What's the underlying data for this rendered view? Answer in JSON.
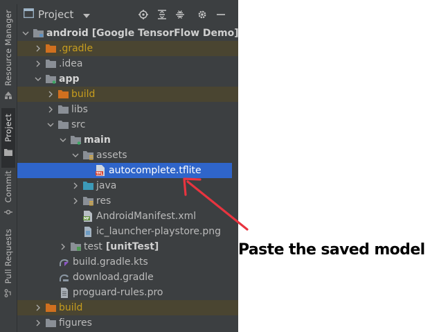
{
  "sidebar": {
    "tabs": [
      {
        "label": "Resource Manager",
        "icon": "resource-manager-icon"
      },
      {
        "label": "Project",
        "icon": "project-folder-icon",
        "active": true
      },
      {
        "label": "Commit",
        "icon": "commit-icon"
      },
      {
        "label": "Pull Requests",
        "icon": "pull-requests-icon"
      }
    ]
  },
  "panel": {
    "title": "Project",
    "toolbar": [
      "locate-icon",
      "expand-all-icon",
      "collapse-all-icon",
      "gear-icon",
      "minimize-icon"
    ]
  },
  "tree": [
    {
      "label": "android",
      "suffix": "[Google TensorFlow Demo]",
      "expanded": true
    },
    {
      "label": ".gradle",
      "expanded": false,
      "excluded": true
    },
    {
      "label": ".idea",
      "expanded": false
    },
    {
      "label": "app",
      "expanded": true
    },
    {
      "label": "build",
      "expanded": false,
      "excluded": true
    },
    {
      "label": "libs",
      "expanded": false
    },
    {
      "label": "src",
      "expanded": true
    },
    {
      "label": "main",
      "expanded": true
    },
    {
      "label": "assets",
      "expanded": true
    },
    {
      "label": "autocomplete.tflite",
      "selected": true
    },
    {
      "label": "java",
      "expanded": false
    },
    {
      "label": "res",
      "expanded": false
    },
    {
      "label": "AndroidManifest.xml"
    },
    {
      "label": "ic_launcher-playstore.png"
    },
    {
      "label": "test",
      "suffix": "[unitTest]",
      "expanded": false
    },
    {
      "label": "build.gradle.kts"
    },
    {
      "label": "download.gradle"
    },
    {
      "label": "proguard-rules.pro"
    },
    {
      "label": "build",
      "expanded": false,
      "excluded": true
    },
    {
      "label": "figures",
      "expanded": false
    }
  ],
  "annotation": {
    "text": "Paste the saved model",
    "arrow_color": "#e8343f"
  },
  "colors": {
    "panel_bg": "#3c3f41",
    "selection": "#2f65ca",
    "excluded_bg": "#4a4531",
    "excluded_text": "#c79d1e",
    "folder": "#8a8f96",
    "excluded_folder": "#d0701f",
    "source_folder": "#3c9ab8"
  }
}
